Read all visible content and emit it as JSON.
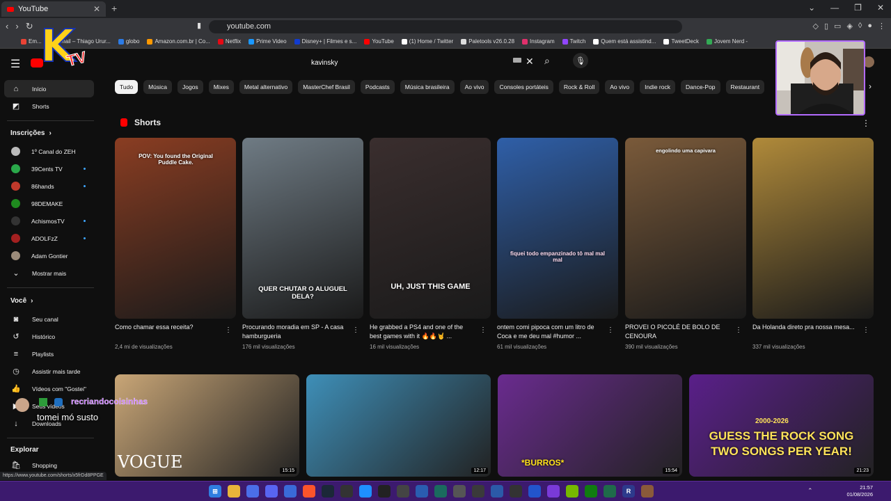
{
  "browser": {
    "tab_title": "YouTube",
    "tab_close": "✕",
    "new_tab": "+",
    "window_controls": [
      "⌄",
      "—",
      "❐",
      "✕"
    ],
    "url": "youtube.com",
    "bookmarks": [
      {
        "label": "Em...",
        "color": "#ea4335"
      },
      {
        "label": "Email – Thiago Urur...",
        "color": "#4285f4"
      },
      {
        "label": "globo",
        "color": "#2c7be5"
      },
      {
        "label": "Amazon.com.br | Co...",
        "color": "#ff9900"
      },
      {
        "label": "Netflix",
        "color": "#e50914"
      },
      {
        "label": "Prime Video",
        "color": "#1a98ff"
      },
      {
        "label": "Disney+ | Filmes e s...",
        "color": "#113ccf"
      },
      {
        "label": "YouTube",
        "color": "#ff0000"
      },
      {
        "label": "(1) Home / Twitter",
        "color": "#ffffff"
      },
      {
        "label": "Paletools v26.0.28",
        "color": "#dddddd"
      },
      {
        "label": "Instagram",
        "color": "#e1306c"
      },
      {
        "label": "Twitch",
        "color": "#9146ff"
      },
      {
        "label": "Quem está assistind...",
        "color": "#ffffff"
      },
      {
        "label": "TweetDeck",
        "color": "#ffffff"
      },
      {
        "label": "Jovem Nerd -",
        "color": "#33aa55"
      }
    ]
  },
  "youtube": {
    "search_value": "kavinsky",
    "clear_icon": "✕",
    "chips": [
      "Tudo",
      "Música",
      "Jogos",
      "Mixes",
      "Metal alternativo",
      "MasterChef Brasil",
      "Podcasts",
      "Música brasileira",
      "Ao vivo",
      "Consoles portáteis",
      "Rock & Roll",
      "Ao vivo",
      "Indie rock",
      "Dance-Pop",
      "Restaurant"
    ],
    "sidebar": {
      "main": [
        {
          "label": "Início",
          "icon": "home-icon"
        },
        {
          "label": "Shorts",
          "icon": "shorts-icon"
        }
      ],
      "subscriptions_heading": "Inscrições",
      "subscriptions": [
        {
          "label": "1º Canal do ZEH",
          "color": "#bbbbbb",
          "new": false
        },
        {
          "label": "39Cents TV",
          "color": "#2aa84a",
          "new": true
        },
        {
          "label": "86hands",
          "color": "#c0392b",
          "new": true
        },
        {
          "label": "98DEMAKE",
          "color": "#1f8a1f",
          "new": false
        },
        {
          "label": "AchismosTV",
          "color": "#333333",
          "new": true
        },
        {
          "label": "ADOLFzZ",
          "color": "#a32020",
          "new": true
        },
        {
          "label": "Adam Gontier",
          "color": "#9b8b7a",
          "new": false
        }
      ],
      "show_more": "Mostrar mais",
      "you_heading": "Você",
      "you_items": [
        {
          "label": "Seu canal",
          "icon": "channel-icon"
        },
        {
          "label": "Histórico",
          "icon": "history-icon"
        },
        {
          "label": "Playlists",
          "icon": "playlists-icon"
        },
        {
          "label": "Assistir mais tarde",
          "icon": "watch-later-icon"
        },
        {
          "label": "Vídeos com \"Gostei\"",
          "icon": "like-icon"
        },
        {
          "label": "Seus vídeos",
          "icon": "your-videos-icon"
        },
        {
          "label": "Downloads",
          "icon": "downloads-icon"
        }
      ],
      "explore_heading": "Explorar",
      "explore_items": [
        {
          "label": "Shopping",
          "icon": "shopping-icon"
        }
      ]
    },
    "shorts_heading": "Shorts",
    "shorts": [
      {
        "title": "Como chamar essa receita?",
        "views": "2,4 mi de visualizações",
        "overlay": "POV: You found the Original Puddle Cake.",
        "bg": "#8a3d22"
      },
      {
        "title": "Procurando moradia em SP - A casa hamburgueria",
        "views": "176 mil visualizações",
        "overlay": "QUER CHUTAR O ALUGUEL DELA?",
        "bg": "#6f7b84"
      },
      {
        "title": "He grabbed a PS4 and one of the best games with it 🔥🔥🤘 ...",
        "views": "16 mil visualizações",
        "overlay": "UH, JUST THIS GAME",
        "bg": "#3a2e2e"
      },
      {
        "title": "ontem comi pipoca com um litro de Coca e me deu mal #humor ...",
        "views": "61 mil visualizações",
        "overlay": "fiquei todo empanzinado tô mal mal mal",
        "bg": "#2f5fa8"
      },
      {
        "title": "PROVEI O PICOLÉ DE BOLO DE CENOURA",
        "views": "390 mil visualizações",
        "overlay": "engolindo uma capivara",
        "bg": "#7a5a3a"
      },
      {
        "title": "Da Holanda direto pra nossa mesa...",
        "views": "337 mil visualizações",
        "overlay": "",
        "bg": "#b08a3a"
      }
    ],
    "videos": [
      {
        "duration": "15:15",
        "overlay": "VOGUE",
        "bg": "#c9a677"
      },
      {
        "duration": "12:17",
        "overlay": "",
        "bg": "#3e8fb8"
      },
      {
        "duration": "15:54",
        "overlay": "*BURROS*",
        "bg": "#6a2b8f"
      },
      {
        "duration": "21:23",
        "overlay": "GUESS THE ROCK SONG TWO SONGS PER YEAR!",
        "overlay_top": "2000-2026",
        "bg": "#5a1f8a"
      }
    ]
  },
  "stream_overlay": {
    "logo_k": "K",
    "logo_tv": "TV",
    "chat_user": "recriandocoisinhas",
    "chat_message": "tomei mó susto"
  },
  "status_url": "https://www.youtube.com/shorts/x5frDd8PPGE",
  "taskbar": {
    "icons": [
      {
        "name": "windows-start-icon",
        "color": "#2f7ee0",
        "glyph": "⊞"
      },
      {
        "name": "file-explorer-icon",
        "color": "#e8b53a",
        "glyph": ""
      },
      {
        "name": "app-icon-1",
        "color": "#4b6ee8",
        "glyph": ""
      },
      {
        "name": "discord-icon",
        "color": "#5865f2",
        "glyph": ""
      },
      {
        "name": "app-icon-2",
        "color": "#3a6ad8",
        "glyph": ""
      },
      {
        "name": "brave-icon",
        "color": "#fb542b",
        "glyph": ""
      },
      {
        "name": "steam-icon",
        "color": "#1b2838",
        "glyph": ""
      },
      {
        "name": "app-icon-3",
        "color": "#333333",
        "glyph": ""
      },
      {
        "name": "app-icon-4",
        "color": "#1e90ff",
        "glyph": ""
      },
      {
        "name": "app-icon-5",
        "color": "#222222",
        "glyph": ""
      },
      {
        "name": "chrome-icon",
        "color": "#444444",
        "glyph": ""
      },
      {
        "name": "app-icon-6",
        "color": "#2a5db0",
        "glyph": ""
      },
      {
        "name": "app-icon-7",
        "color": "#1a6b5e",
        "glyph": ""
      },
      {
        "name": "app-icon-8",
        "color": "#555555",
        "glyph": ""
      },
      {
        "name": "app-icon-9",
        "color": "#3a3a3a",
        "glyph": ""
      },
      {
        "name": "app-icon-10",
        "color": "#2b5aa8",
        "glyph": ""
      },
      {
        "name": "app-icon-11",
        "color": "#333333",
        "glyph": ""
      },
      {
        "name": "app-icon-12",
        "color": "#2255cc",
        "glyph": ""
      },
      {
        "name": "app-icon-13",
        "color": "#7a3ad8",
        "glyph": ""
      },
      {
        "name": "nvidia-icon",
        "color": "#76b900",
        "glyph": ""
      },
      {
        "name": "xbox-icon",
        "color": "#107c10",
        "glyph": ""
      },
      {
        "name": "app-icon-14",
        "color": "#1f6b4a",
        "glyph": ""
      },
      {
        "name": "app-icon-15",
        "color": "#2d3a8c",
        "glyph": "R"
      },
      {
        "name": "app-icon-16",
        "color": "#8a5a3a",
        "glyph": ""
      }
    ],
    "time": "21:57",
    "date": "01/08/2026"
  }
}
